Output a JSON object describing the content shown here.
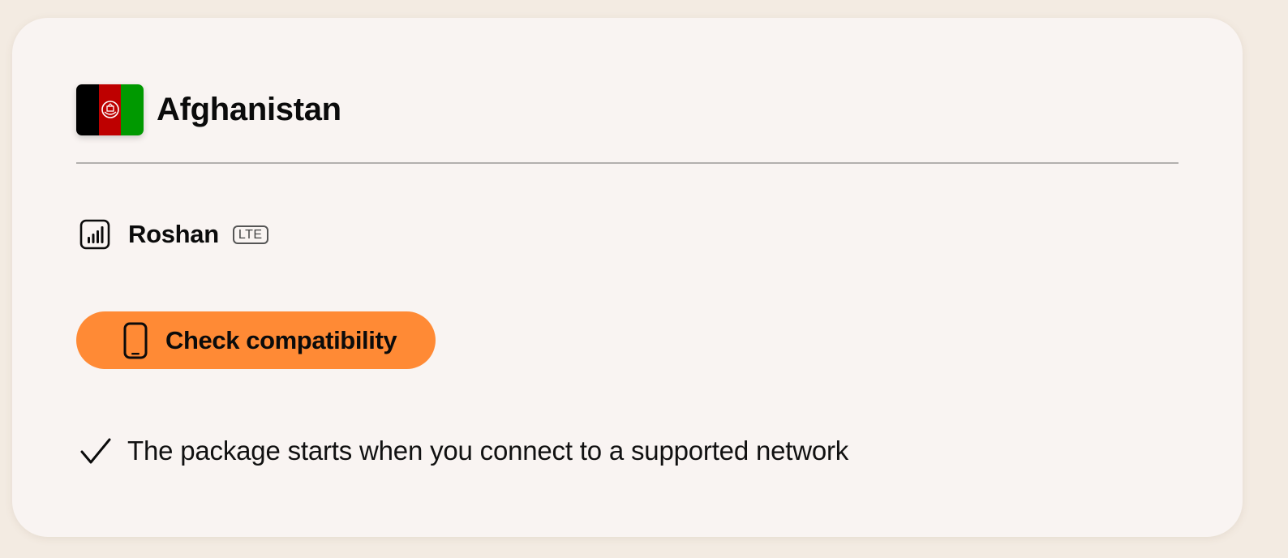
{
  "country": {
    "name": "Afghanistan",
    "flag_icon": "afghanistan-flag-icon",
    "flag_colors": [
      "#000000",
      "#be0000",
      "#009900"
    ]
  },
  "network": {
    "icon": "signal-bars-icon",
    "name": "Roshan",
    "badge": "LTE"
  },
  "compatibility_button": {
    "icon": "smartphone-icon",
    "label": "Check compatibility",
    "color": "#ff8a35"
  },
  "info": {
    "icon": "checkmark-icon",
    "text": "The package starts when you connect to a supported network"
  },
  "colors": {
    "page_background": "#f3ebe2",
    "card_background": "#f9f4f2",
    "divider": "#b3b0ae"
  }
}
